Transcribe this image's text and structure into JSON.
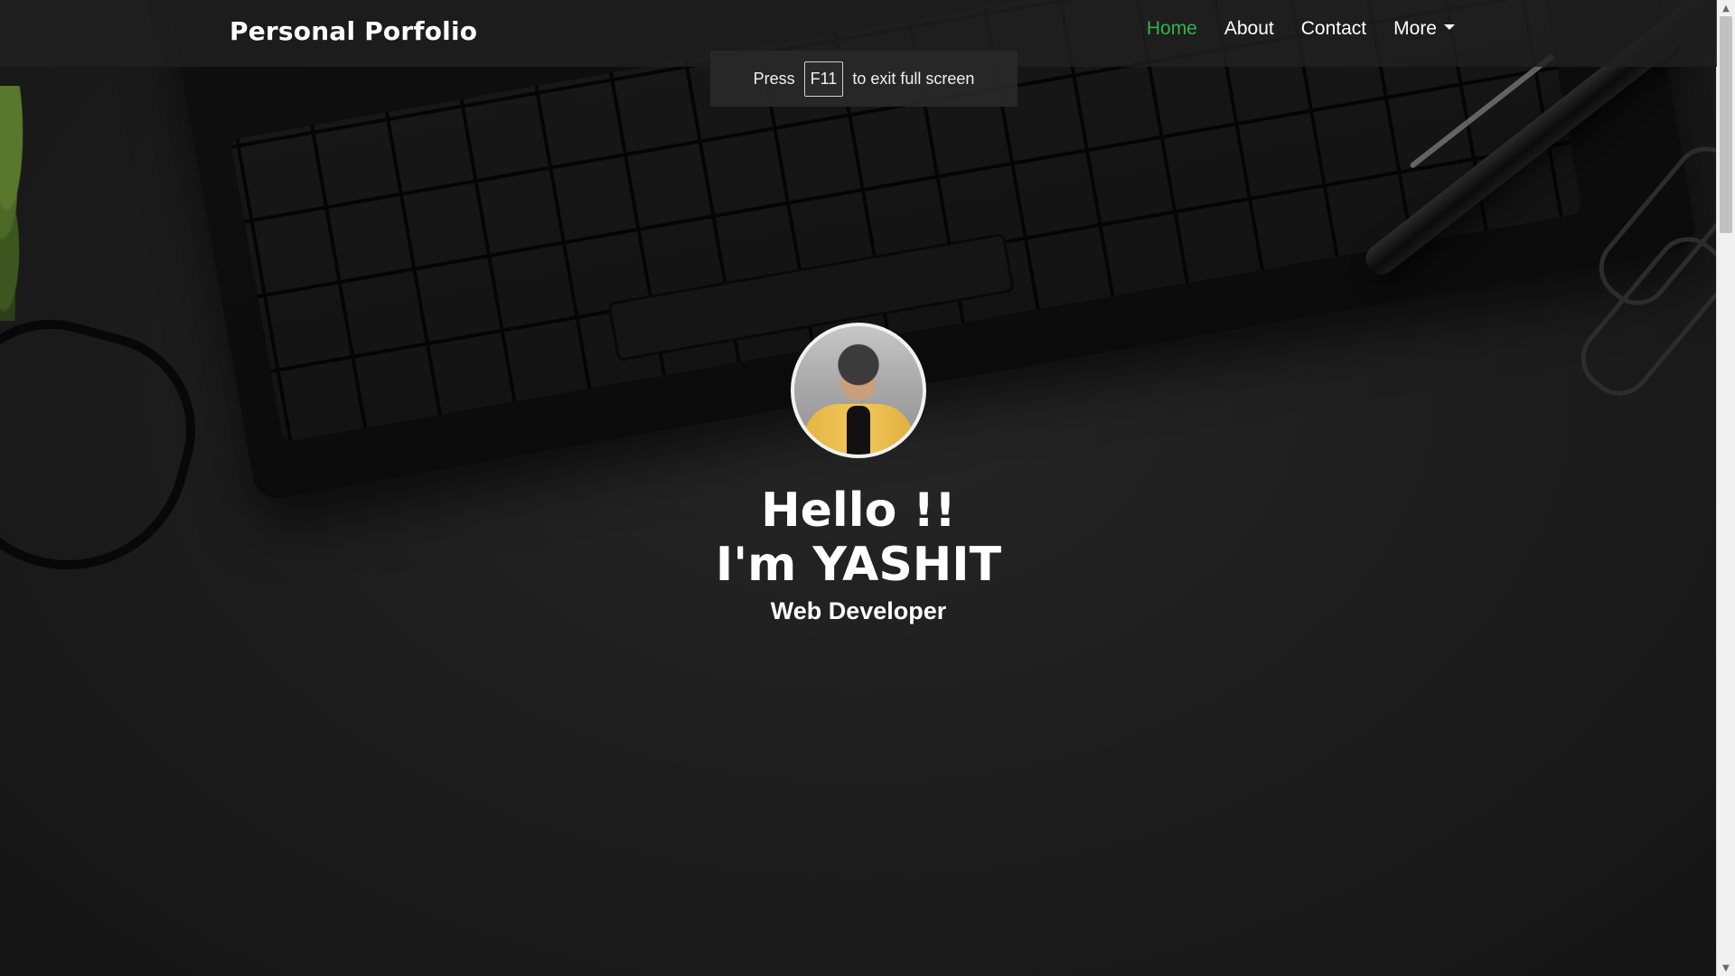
{
  "navbar": {
    "brand": "Personal Porfolio",
    "links": [
      {
        "label": "Home",
        "active": true
      },
      {
        "label": "About",
        "active": false
      },
      {
        "label": "Contact",
        "active": false
      },
      {
        "label": "More",
        "active": false
      }
    ]
  },
  "fullscreen_notice": {
    "press": "Press",
    "key": "F11",
    "suffix": "to exit full screen"
  },
  "hero": {
    "line1": "Hello !!",
    "line2": "I'm YASHIT",
    "role": "Web Developer"
  },
  "colors": {
    "accent_active": "#33b24a",
    "text": "#ffffff"
  }
}
